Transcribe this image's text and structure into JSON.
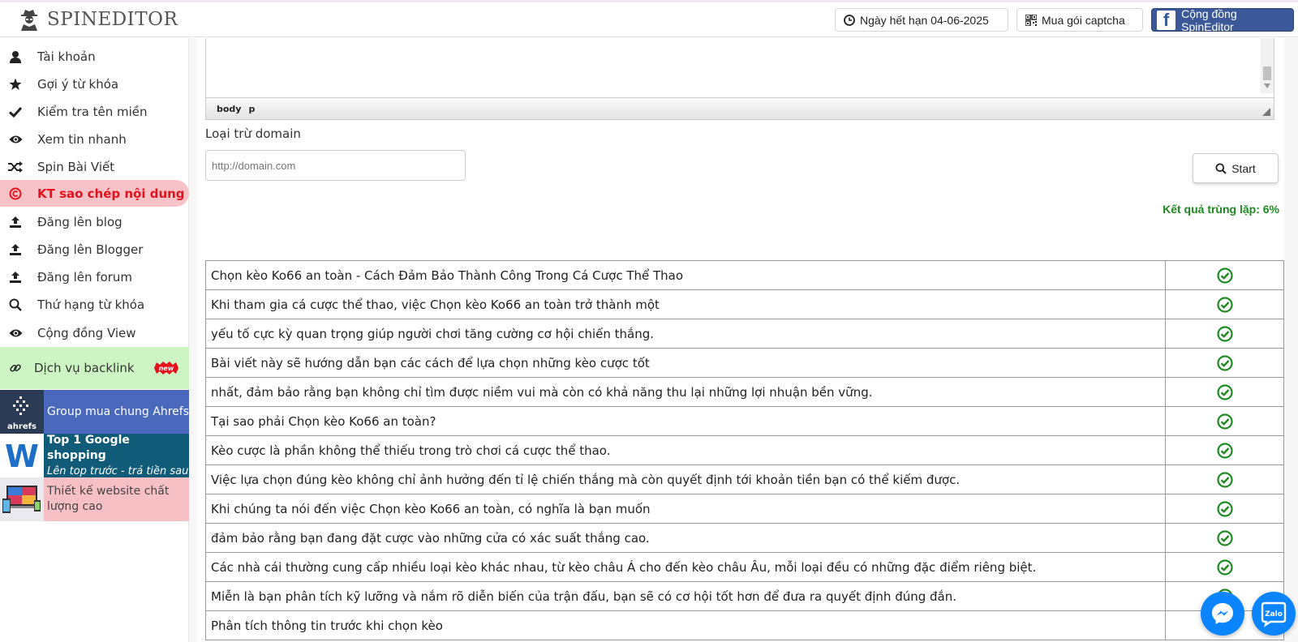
{
  "header": {
    "logo_text": "SPINEDITOR",
    "expiry_label": "Ngày hết hạn 04-06-2025",
    "captcha_label": "Mua gói captcha",
    "community_label": "Cộng đồng SpinEditor",
    "fb_letter": "f"
  },
  "sidebar": {
    "items": [
      {
        "label": "Tài khoản",
        "icon": "user-icon"
      },
      {
        "label": "Gợi ý từ khóa",
        "icon": "star-icon"
      },
      {
        "label": "Kiểm tra tên miền",
        "icon": "check-icon"
      },
      {
        "label": "Xem tin nhanh",
        "icon": "eye-icon"
      },
      {
        "label": "Spin Bài Viết",
        "icon": "shuffle-icon"
      },
      {
        "label": "KT sao chép nội dung",
        "icon": "copyright-icon"
      },
      {
        "label": "Đăng lên blog",
        "icon": "upload-icon"
      },
      {
        "label": "Đăng lên Blogger",
        "icon": "upload-icon"
      },
      {
        "label": "Đăng lên forum",
        "icon": "upload-icon"
      },
      {
        "label": "Thứ hạng từ khóa",
        "icon": "search-icon"
      },
      {
        "label": "Cộng đồng View",
        "icon": "eye-icon"
      },
      {
        "label": "Dịch vụ backlink",
        "icon": "link-icon"
      }
    ],
    "new_badge": "new",
    "promos": {
      "ahrefs": {
        "text": "Group mua chung Ahrefs",
        "logo": "ahrefs"
      },
      "google": {
        "line1": "Top 1 Google shopping",
        "line2": "Lên top trước - trả tiền sau",
        "logo": "W"
      },
      "web": {
        "text": "Thiết kế website chất lượng cao"
      }
    }
  },
  "editor": {
    "status_tags": [
      "body",
      "p"
    ]
  },
  "form": {
    "exclude_label": "Loại trừ domain",
    "domain_placeholder": "http://domain.com",
    "start_label": "Start",
    "result_text": "Kết quả trùng lặp: 6%"
  },
  "results": [
    {
      "text": "Chọn kèo Ko66 an toàn - Cách Đảm Bảo Thành Công Trong Cá Cược Thể Thao",
      "ok": true
    },
    {
      "text": "Khi tham gia cá cược thể thao, việc Chọn kèo Ko66 an toàn trở thành một",
      "ok": true
    },
    {
      "text": "yếu tố cực kỳ quan trọng giúp người chơi tăng cường cơ hội chiến thắng.",
      "ok": true
    },
    {
      "text": "Bài viết này sẽ hướng dẫn bạn các cách để lựa chọn những kèo cược tốt",
      "ok": true
    },
    {
      "text": "nhất, đảm bảo rằng bạn không chỉ tìm được niềm vui mà còn có khả năng thu lại những lợi nhuận bền vững.",
      "ok": true
    },
    {
      "text": "Tại sao phải Chọn kèo Ko66 an toàn?",
      "ok": true
    },
    {
      "text": "Kèo cược là phần không thể thiếu trong trò chơi cá cược thể thao.",
      "ok": true
    },
    {
      "text": "Việc lựa chọn đúng kèo không chỉ ảnh hưởng đến tỉ lệ chiến thắng mà còn quyết định tới khoản tiền bạn có thể kiếm được.",
      "ok": true
    },
    {
      "text": "Khi chúng ta nói đến việc Chọn kèo Ko66 an toàn, có nghĩa là bạn muốn",
      "ok": true
    },
    {
      "text": "đảm bảo rằng bạn đang đặt cược vào những cửa có xác suất thắng cao.",
      "ok": true
    },
    {
      "text": "Các nhà cái thường cung cấp nhiều loại kèo khác nhau, từ kèo châu Á cho đến kèo châu Âu, mỗi loại đều có những đặc điểm riêng biệt.",
      "ok": true
    },
    {
      "text": "Miễn là bạn phân tích kỹ lưỡng và nắm rõ diễn biến của trận đấu, bạn sẽ có cơ hội tốt hơn để đưa ra quyết định đúng đắn.",
      "ok": true
    },
    {
      "text": "Phân tích thông tin trước khi chọn kèo",
      "ok": false
    }
  ],
  "colors": {
    "accent_red": "#e3121d",
    "active_bg": "#f7c3c8",
    "backlink_bg": "#cdf5c4",
    "ok_green": "#1f8a1f",
    "fb_blue": "#3b5998",
    "chat_blue": "#0a84ff"
  },
  "chat": {
    "zalo_label": "Zalo"
  }
}
